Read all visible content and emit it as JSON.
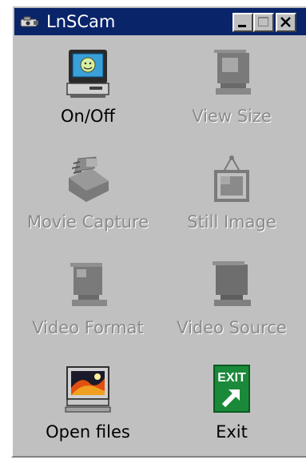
{
  "window": {
    "title": "LnSCam",
    "controls": {
      "minimize": "minimize-button",
      "maximize": "maximize-button",
      "close": "close-button"
    }
  },
  "colors": {
    "face": "#c0c0c0",
    "titlebar": "#0a246a",
    "disabled_text": "#8a8a8a",
    "exit_green": "#1a8a3a"
  },
  "buttons": [
    {
      "label": "On/Off",
      "icon": "monitor-icon",
      "enabled": true
    },
    {
      "label": "View Size",
      "icon": "view-size-icon",
      "enabled": false
    },
    {
      "label": "Movie Capture",
      "icon": "movie-capture-icon",
      "enabled": false
    },
    {
      "label": "Still Image",
      "icon": "still-image-icon",
      "enabled": false
    },
    {
      "label": "Video Format",
      "icon": "video-format-icon",
      "enabled": false
    },
    {
      "label": "Video Source",
      "icon": "video-source-icon",
      "enabled": false
    },
    {
      "label": "Open files",
      "icon": "open-files-icon",
      "enabled": true
    },
    {
      "label": "Exit",
      "icon": "exit-icon",
      "enabled": true
    }
  ],
  "exit_sign_text": "EXIT"
}
